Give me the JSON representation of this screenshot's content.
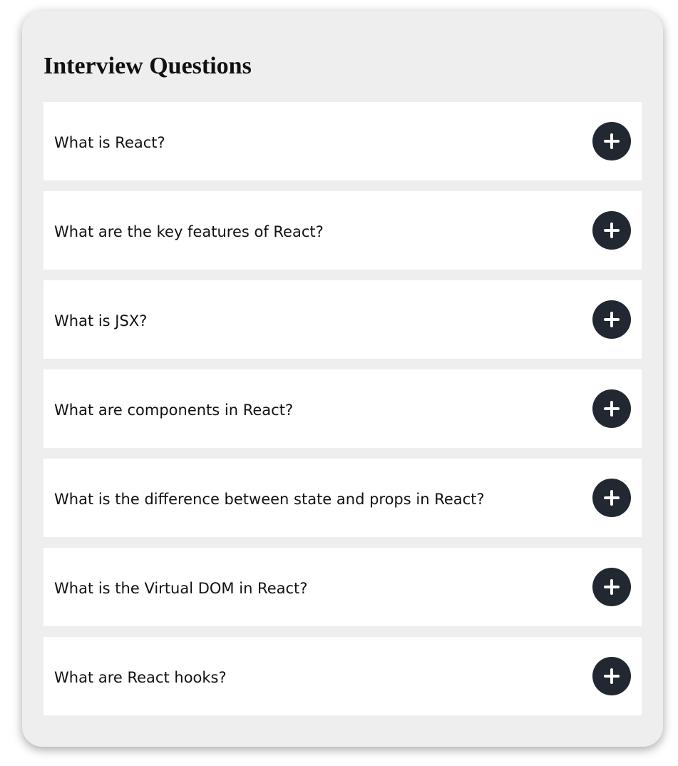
{
  "page": {
    "title": "Interview Questions"
  },
  "faq": {
    "items": [
      {
        "question": "What is React?",
        "icon": "plus-icon"
      },
      {
        "question": "What are the key features of React?",
        "icon": "plus-icon"
      },
      {
        "question": "What is JSX?",
        "icon": "plus-icon"
      },
      {
        "question": "What are components in React?",
        "icon": "plus-icon"
      },
      {
        "question": "What is the difference between state and props in React?",
        "icon": "plus-icon"
      },
      {
        "question": "What is the Virtual DOM in React?",
        "icon": "plus-icon"
      },
      {
        "question": "What are React hooks?",
        "icon": "plus-icon"
      }
    ]
  },
  "colors": {
    "card_background": "#eeeeee",
    "item_background": "#ffffff",
    "toggle_background": "#222831",
    "toggle_icon": "#ffffff"
  }
}
